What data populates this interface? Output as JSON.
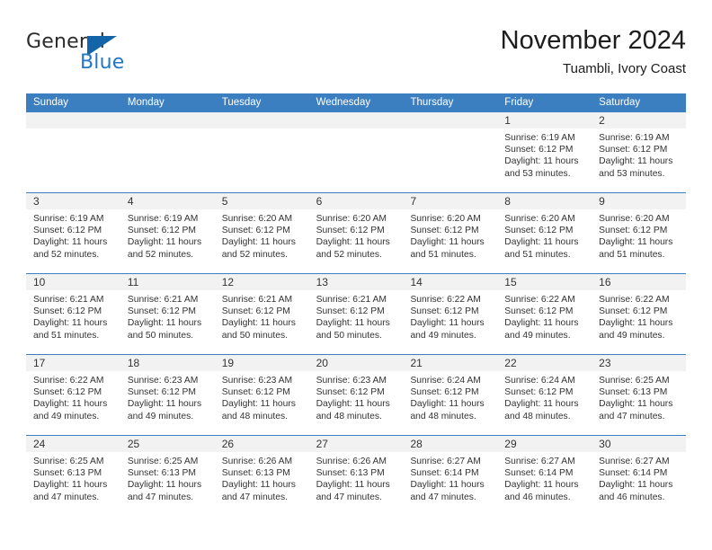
{
  "brand": {
    "name_part1": "General",
    "name_part2": "Blue",
    "triangle_color": "#1464aa",
    "blue_color": "#2277c8"
  },
  "header": {
    "title": "November 2024",
    "subtitle": "Tuambli, Ivory Coast"
  },
  "theme": {
    "header_blue": "#3c7fc1",
    "day_band_gray": "#f2f2f2",
    "text": "#333333"
  },
  "weekdays": [
    "Sunday",
    "Monday",
    "Tuesday",
    "Wednesday",
    "Thursday",
    "Friday",
    "Saturday"
  ],
  "weeks": [
    [
      {
        "day": "",
        "sunrise": "",
        "sunset": "",
        "daylight1": "",
        "daylight2": ""
      },
      {
        "day": "",
        "sunrise": "",
        "sunset": "",
        "daylight1": "",
        "daylight2": ""
      },
      {
        "day": "",
        "sunrise": "",
        "sunset": "",
        "daylight1": "",
        "daylight2": ""
      },
      {
        "day": "",
        "sunrise": "",
        "sunset": "",
        "daylight1": "",
        "daylight2": ""
      },
      {
        "day": "",
        "sunrise": "",
        "sunset": "",
        "daylight1": "",
        "daylight2": ""
      },
      {
        "day": "1",
        "sunrise": "Sunrise: 6:19 AM",
        "sunset": "Sunset: 6:12 PM",
        "daylight1": "Daylight: 11 hours",
        "daylight2": "and 53 minutes."
      },
      {
        "day": "2",
        "sunrise": "Sunrise: 6:19 AM",
        "sunset": "Sunset: 6:12 PM",
        "daylight1": "Daylight: 11 hours",
        "daylight2": "and 53 minutes."
      }
    ],
    [
      {
        "day": "3",
        "sunrise": "Sunrise: 6:19 AM",
        "sunset": "Sunset: 6:12 PM",
        "daylight1": "Daylight: 11 hours",
        "daylight2": "and 52 minutes."
      },
      {
        "day": "4",
        "sunrise": "Sunrise: 6:19 AM",
        "sunset": "Sunset: 6:12 PM",
        "daylight1": "Daylight: 11 hours",
        "daylight2": "and 52 minutes."
      },
      {
        "day": "5",
        "sunrise": "Sunrise: 6:20 AM",
        "sunset": "Sunset: 6:12 PM",
        "daylight1": "Daylight: 11 hours",
        "daylight2": "and 52 minutes."
      },
      {
        "day": "6",
        "sunrise": "Sunrise: 6:20 AM",
        "sunset": "Sunset: 6:12 PM",
        "daylight1": "Daylight: 11 hours",
        "daylight2": "and 52 minutes."
      },
      {
        "day": "7",
        "sunrise": "Sunrise: 6:20 AM",
        "sunset": "Sunset: 6:12 PM",
        "daylight1": "Daylight: 11 hours",
        "daylight2": "and 51 minutes."
      },
      {
        "day": "8",
        "sunrise": "Sunrise: 6:20 AM",
        "sunset": "Sunset: 6:12 PM",
        "daylight1": "Daylight: 11 hours",
        "daylight2": "and 51 minutes."
      },
      {
        "day": "9",
        "sunrise": "Sunrise: 6:20 AM",
        "sunset": "Sunset: 6:12 PM",
        "daylight1": "Daylight: 11 hours",
        "daylight2": "and 51 minutes."
      }
    ],
    [
      {
        "day": "10",
        "sunrise": "Sunrise: 6:21 AM",
        "sunset": "Sunset: 6:12 PM",
        "daylight1": "Daylight: 11 hours",
        "daylight2": "and 51 minutes."
      },
      {
        "day": "11",
        "sunrise": "Sunrise: 6:21 AM",
        "sunset": "Sunset: 6:12 PM",
        "daylight1": "Daylight: 11 hours",
        "daylight2": "and 50 minutes."
      },
      {
        "day": "12",
        "sunrise": "Sunrise: 6:21 AM",
        "sunset": "Sunset: 6:12 PM",
        "daylight1": "Daylight: 11 hours",
        "daylight2": "and 50 minutes."
      },
      {
        "day": "13",
        "sunrise": "Sunrise: 6:21 AM",
        "sunset": "Sunset: 6:12 PM",
        "daylight1": "Daylight: 11 hours",
        "daylight2": "and 50 minutes."
      },
      {
        "day": "14",
        "sunrise": "Sunrise: 6:22 AM",
        "sunset": "Sunset: 6:12 PM",
        "daylight1": "Daylight: 11 hours",
        "daylight2": "and 49 minutes."
      },
      {
        "day": "15",
        "sunrise": "Sunrise: 6:22 AM",
        "sunset": "Sunset: 6:12 PM",
        "daylight1": "Daylight: 11 hours",
        "daylight2": "and 49 minutes."
      },
      {
        "day": "16",
        "sunrise": "Sunrise: 6:22 AM",
        "sunset": "Sunset: 6:12 PM",
        "daylight1": "Daylight: 11 hours",
        "daylight2": "and 49 minutes."
      }
    ],
    [
      {
        "day": "17",
        "sunrise": "Sunrise: 6:22 AM",
        "sunset": "Sunset: 6:12 PM",
        "daylight1": "Daylight: 11 hours",
        "daylight2": "and 49 minutes."
      },
      {
        "day": "18",
        "sunrise": "Sunrise: 6:23 AM",
        "sunset": "Sunset: 6:12 PM",
        "daylight1": "Daylight: 11 hours",
        "daylight2": "and 49 minutes."
      },
      {
        "day": "19",
        "sunrise": "Sunrise: 6:23 AM",
        "sunset": "Sunset: 6:12 PM",
        "daylight1": "Daylight: 11 hours",
        "daylight2": "and 48 minutes."
      },
      {
        "day": "20",
        "sunrise": "Sunrise: 6:23 AM",
        "sunset": "Sunset: 6:12 PM",
        "daylight1": "Daylight: 11 hours",
        "daylight2": "and 48 minutes."
      },
      {
        "day": "21",
        "sunrise": "Sunrise: 6:24 AM",
        "sunset": "Sunset: 6:12 PM",
        "daylight1": "Daylight: 11 hours",
        "daylight2": "and 48 minutes."
      },
      {
        "day": "22",
        "sunrise": "Sunrise: 6:24 AM",
        "sunset": "Sunset: 6:12 PM",
        "daylight1": "Daylight: 11 hours",
        "daylight2": "and 48 minutes."
      },
      {
        "day": "23",
        "sunrise": "Sunrise: 6:25 AM",
        "sunset": "Sunset: 6:13 PM",
        "daylight1": "Daylight: 11 hours",
        "daylight2": "and 47 minutes."
      }
    ],
    [
      {
        "day": "24",
        "sunrise": "Sunrise: 6:25 AM",
        "sunset": "Sunset: 6:13 PM",
        "daylight1": "Daylight: 11 hours",
        "daylight2": "and 47 minutes."
      },
      {
        "day": "25",
        "sunrise": "Sunrise: 6:25 AM",
        "sunset": "Sunset: 6:13 PM",
        "daylight1": "Daylight: 11 hours",
        "daylight2": "and 47 minutes."
      },
      {
        "day": "26",
        "sunrise": "Sunrise: 6:26 AM",
        "sunset": "Sunset: 6:13 PM",
        "daylight1": "Daylight: 11 hours",
        "daylight2": "and 47 minutes."
      },
      {
        "day": "27",
        "sunrise": "Sunrise: 6:26 AM",
        "sunset": "Sunset: 6:13 PM",
        "daylight1": "Daylight: 11 hours",
        "daylight2": "and 47 minutes."
      },
      {
        "day": "28",
        "sunrise": "Sunrise: 6:27 AM",
        "sunset": "Sunset: 6:14 PM",
        "daylight1": "Daylight: 11 hours",
        "daylight2": "and 47 minutes."
      },
      {
        "day": "29",
        "sunrise": "Sunrise: 6:27 AM",
        "sunset": "Sunset: 6:14 PM",
        "daylight1": "Daylight: 11 hours",
        "daylight2": "and 46 minutes."
      },
      {
        "day": "30",
        "sunrise": "Sunrise: 6:27 AM",
        "sunset": "Sunset: 6:14 PM",
        "daylight1": "Daylight: 11 hours",
        "daylight2": "and 46 minutes."
      }
    ]
  ]
}
